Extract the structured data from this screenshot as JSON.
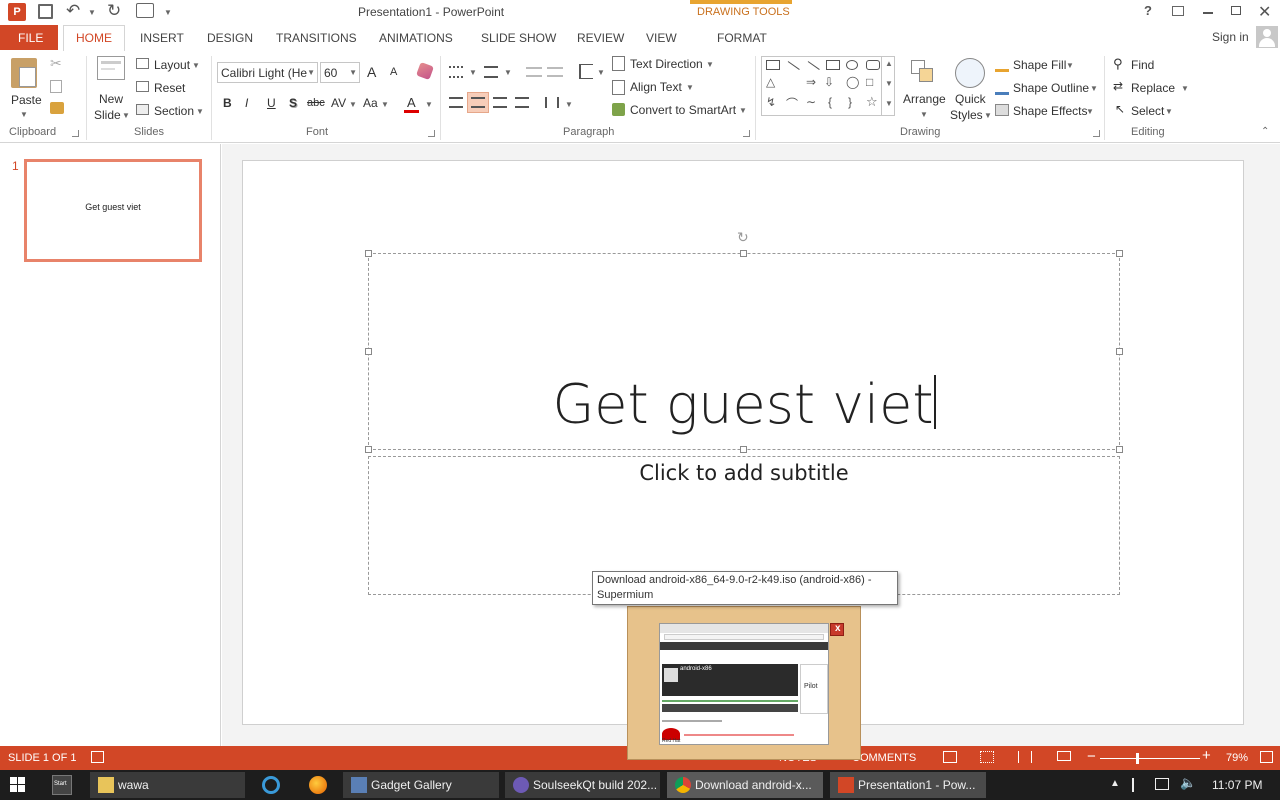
{
  "window": {
    "title": "Presentation1 - PowerPoint",
    "context_tab": "DRAWING TOOLS",
    "help": "?",
    "signin": "Sign in"
  },
  "tabs": [
    "FILE",
    "HOME",
    "INSERT",
    "DESIGN",
    "TRANSITIONS",
    "ANIMATIONS",
    "SLIDE SHOW",
    "REVIEW",
    "VIEW",
    "FORMAT"
  ],
  "ribbon": {
    "clipboard": {
      "paste": "Paste",
      "group": "Clipboard"
    },
    "slides": {
      "new_slide": "New",
      "new_slide2": "Slide",
      "layout": "Layout",
      "reset": "Reset",
      "section": "Section",
      "group": "Slides"
    },
    "font": {
      "name": "Calibri Light (He",
      "size": "60",
      "bold": "B",
      "italic": "I",
      "underline": "U",
      "shadow": "S",
      "strike": "abc",
      "spacing": "AV",
      "case": "Aa",
      "color": "A",
      "grow": "A",
      "shrink": "A",
      "group": "Font"
    },
    "paragraph": {
      "text_direction": "Text Direction",
      "align_text": "Align Text",
      "smartart": "Convert to SmartArt",
      "group": "Paragraph"
    },
    "drawing": {
      "arrange": "Arrange",
      "quick": "Quick",
      "styles": "Styles",
      "fill": "Shape Fill",
      "outline": "Shape Outline",
      "effects": "Shape Effects",
      "group": "Drawing"
    },
    "editing": {
      "find": "Find",
      "replace": "Replace",
      "select": "Select",
      "group": "Editing"
    }
  },
  "thumbnail": {
    "number": "1",
    "text": "Get guest viet"
  },
  "slide": {
    "title": "Get guest viet",
    "subtitle": "Click to add subtitle"
  },
  "tooltip": {
    "line1": "Download android-x86_64-9.0-r2-k49.iso (android-x86) -",
    "line2": "Supermium"
  },
  "preview": {
    "close": "x",
    "site_title": "android-x86",
    "side": "Pilot",
    "footer": "Red Hat"
  },
  "status": {
    "slide": "SLIDE 1 OF 1",
    "notes": "NOTES",
    "comments": "COMMENTS",
    "zoom": "79%"
  },
  "taskbar": {
    "start": "Start",
    "items": [
      "wawa",
      "Gadget Gallery",
      "SoulseekQt build 202...",
      "Download android-x...",
      "Presentation1 - Pow..."
    ],
    "clock": "11:07 PM"
  },
  "colors": {
    "accent": "#d24726",
    "context": "#e8a430"
  }
}
